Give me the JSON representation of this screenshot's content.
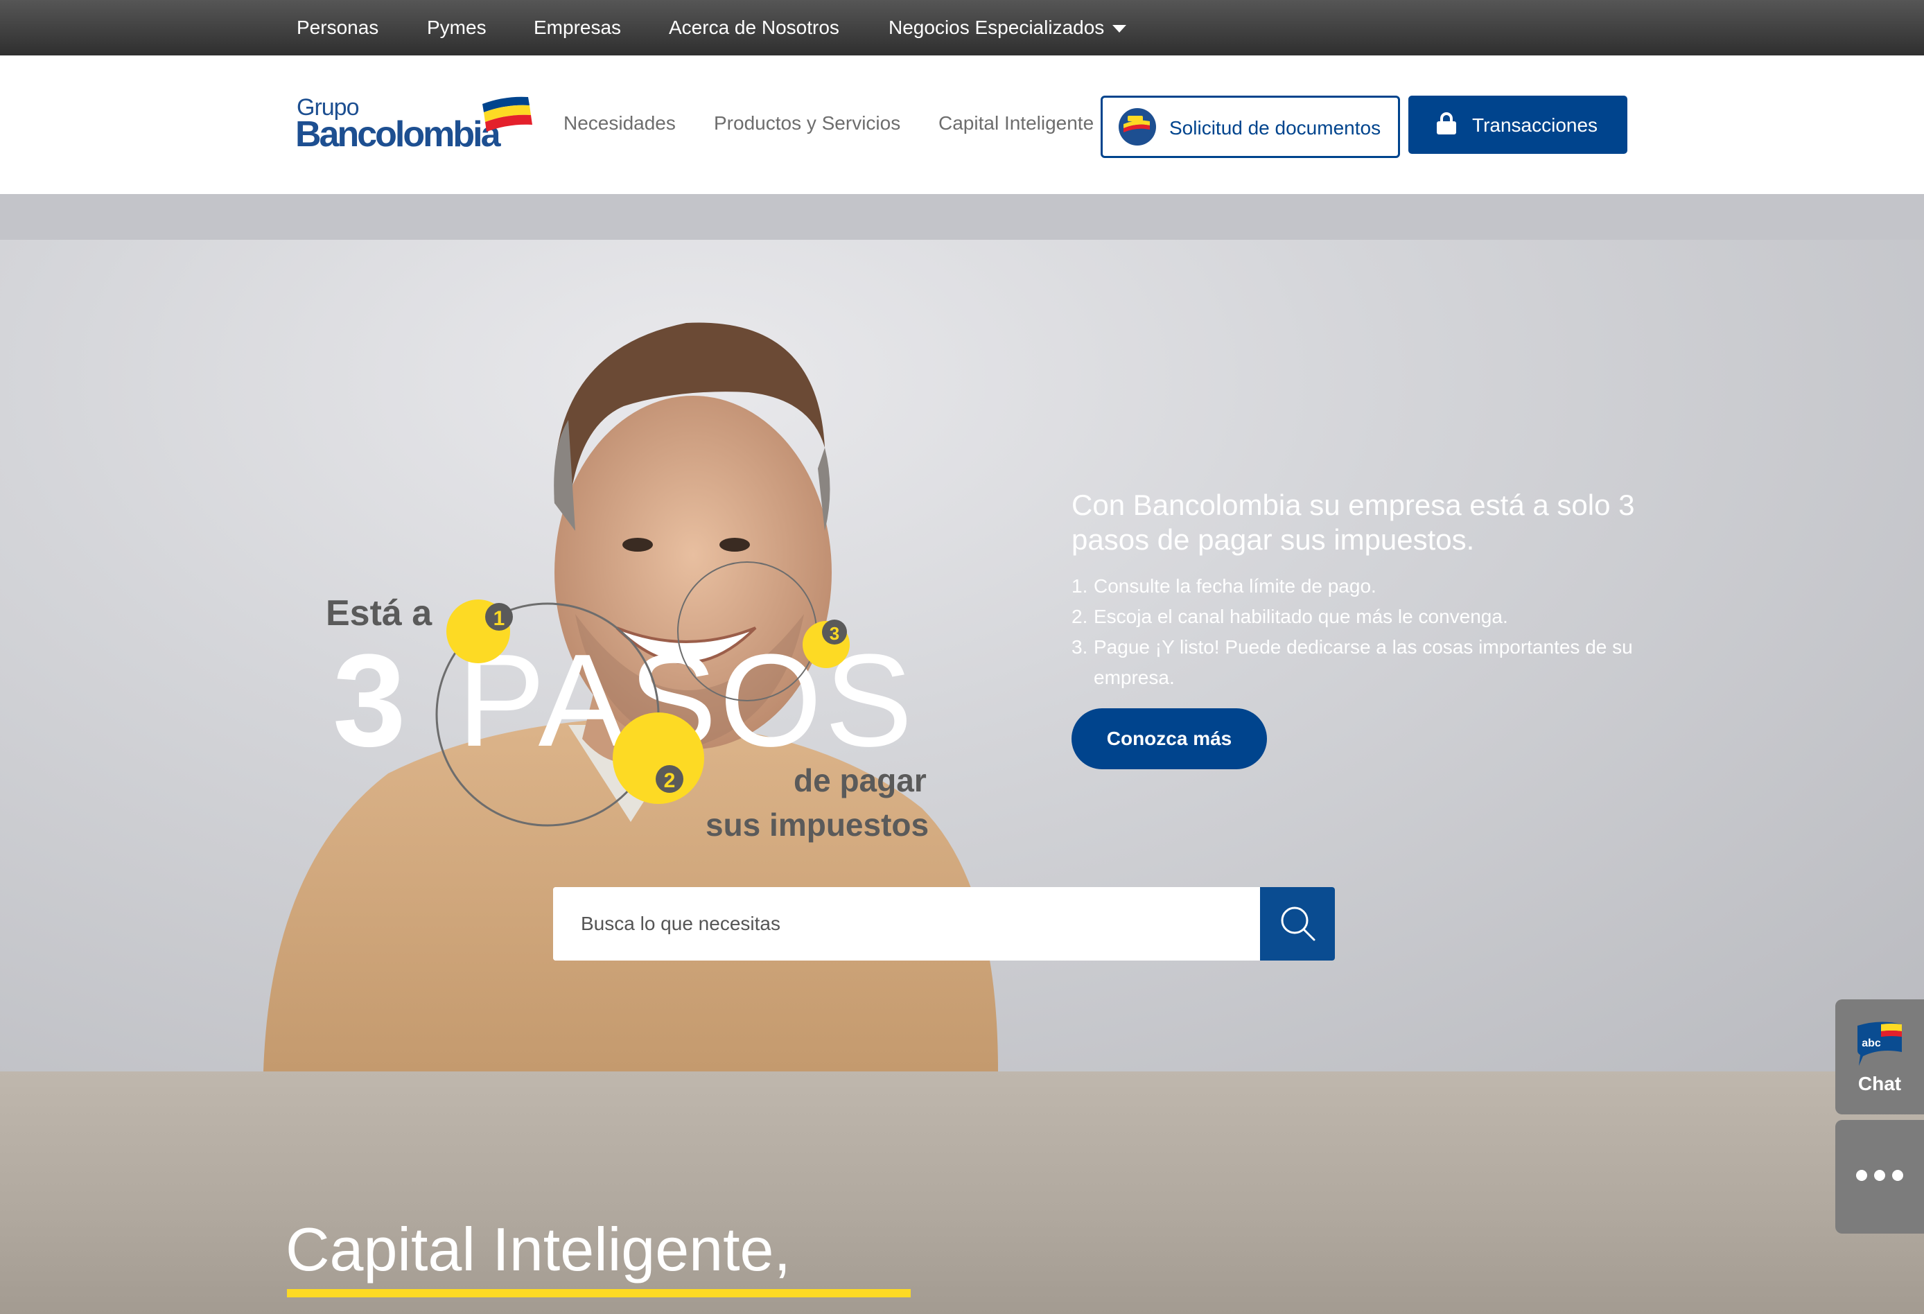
{
  "topbar": {
    "items": [
      "Personas",
      "Pymes",
      "Empresas",
      "Acerca de Nosotros",
      "Negocios Especializados"
    ]
  },
  "header": {
    "logo_line1": "Grupo",
    "logo_line2": "Bancolombia",
    "nav": [
      "Necesidades",
      "Productos y Servicios",
      "Capital Inteligente"
    ],
    "docs_button": "Solicitud de documentos",
    "transactions_button": "Transacciones"
  },
  "hero": {
    "image_text": {
      "line1": "Está a",
      "number": "3",
      "word": "PASOS",
      "line3": "de pagar",
      "line4": "sus impuestos",
      "steps": [
        "1",
        "2",
        "3"
      ]
    },
    "title": "Con Bancolombia su empresa está a solo 3 pasos de pagar sus impuestos.",
    "steps": [
      "Consulte la fecha límite de pago.",
      "Escoja el canal habilitado que más le convenga.",
      "Pague ¡Y listo! Puede dedicarse a las cosas importantes de su empresa."
    ],
    "step_numbers": [
      "1.",
      "2.",
      "3."
    ],
    "cta": "Conozca más"
  },
  "search": {
    "placeholder": "Busca lo que necesitas"
  },
  "section2": {
    "title": "Capital Inteligente,"
  },
  "chat": {
    "label": "Chat",
    "badge": "abc"
  },
  "colors": {
    "brand_blue": "#00448d",
    "brand_yellow": "#fdda24",
    "brand_red": "#e4202b"
  }
}
